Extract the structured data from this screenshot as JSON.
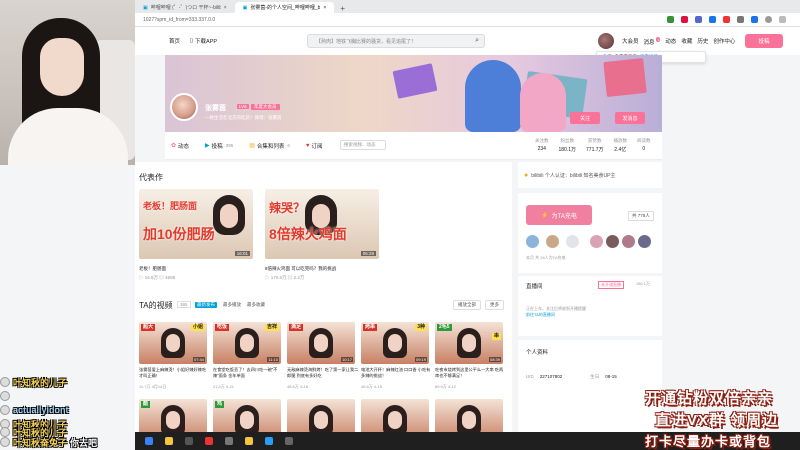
{
  "browser": {
    "tabs": [
      {
        "label": "哔哩哔哩 (゜-゜)つロ 干杯~-bilibili",
        "active": false
      },
      {
        "label": "张雾茵-的个人空间_哔哩哔哩_bilibili",
        "active": true
      }
    ],
    "url": "1027?spm_id_from=333.337.0.0"
  },
  "site_header": {
    "home": "首页",
    "app": "下载APP",
    "search_placeholder": "【熟肉】地铁飞胸比赛的骚货，看见追尾了！",
    "nav": [
      "大会员",
      "消息",
      "动态",
      "收藏",
      "历史",
      "创作中心"
    ],
    "upload": "投稿",
    "message_badge": "1",
    "tooltip": "你有6条充电消息",
    "tooltip_link": "查看详情"
  },
  "profile": {
    "name": "张雾茵",
    "level": "LV6",
    "vip": "年度大会员",
    "bio": "一枚生活在北京的吃货！微博：张雾茵",
    "follow": "关注",
    "message": "发消息"
  },
  "profile_nav": {
    "items": [
      {
        "label": "动态",
        "count": ""
      },
      {
        "label": "投稿",
        "count": "395"
      },
      {
        "label": "合集和列表",
        "count": "6"
      },
      {
        "label": "订阅",
        "count": ""
      }
    ],
    "search_placeholder": "搜索视频、动态"
  },
  "stats": [
    {
      "label": "关注数",
      "value": "234"
    },
    {
      "label": "粉丝数",
      "value": "180.1万"
    },
    {
      "label": "获赞数",
      "value": "771.7万"
    },
    {
      "label": "播放数",
      "value": "2.4亿"
    },
    {
      "label": "阅读数",
      "value": "0"
    }
  ],
  "representative": {
    "heading": "代表作",
    "items": [
      {
        "thumb_line1": "老板！肥肠面",
        "thumb_line2": "加10份肥肠",
        "duration": "16:01",
        "title": "老板！肥肠面",
        "views": "16.8万",
        "danmaku": "4698"
      },
      {
        "thumb_line1": "辣哭？",
        "thumb_line2": "8倍辣火鸡面",
        "duration": "06:29",
        "title": "8倍辣火鸡面 可以吃完吗？我的挑战",
        "views": "170.6万",
        "danmaku": "2.2万"
      }
    ]
  },
  "videos": {
    "heading": "TA的视频",
    "count": "395",
    "tabs": [
      "最新发布",
      "最多播放",
      "最多收藏"
    ],
    "buttons": [
      "播放全部",
      "更多"
    ],
    "items": [
      {
        "tag": "超大",
        "tag2": "小姐",
        "duration": "07:44",
        "title": "张雾茵爱上麻辣烫！小姐好辣好辣吃 才叫正确！",
        "views": "11.7万",
        "date": "4月14日"
      },
      {
        "tag": "吃饭",
        "tag2": "吉祥",
        "duration": "11:10",
        "title": "在食堂吃饭丢了！去四川吃一碗\"不辣\"面条 金年单面",
        "views": "21.5万",
        "date": "4-21"
      },
      {
        "tag": "满足",
        "tag2": "",
        "duration": "10:17",
        "title": "无敌麻辣烫海鲜烤！吃了第一家让我二郎腿 到底有多好吃",
        "views": "48.6万",
        "date": "4-18"
      },
      {
        "tag": "烤串",
        "tag2": "3种",
        "duration": "09:19",
        "title": "电池大开杯！麻辣红油 口口香 小吃有多辣的挑战！",
        "views": "46.8万",
        "date": "4-15"
      },
      {
        "tag": "2毛5",
        "tag2": "串",
        "duration": "08:39",
        "title": "吃夜市烧烤到这里公平么一大串 吃两串也不够满足！",
        "views": "69.9万",
        "date": "4-12"
      },
      {
        "tag": "醋",
        "tag2": "",
        "duration": "",
        "title": "",
        "views": "",
        "date": ""
      },
      {
        "tag": "鸡",
        "tag2": "",
        "duration": "",
        "title": "",
        "views": "",
        "date": ""
      },
      {
        "tag": "",
        "tag2": "",
        "duration": "",
        "title": "",
        "views": "",
        "date": ""
      },
      {
        "tag": "",
        "tag2": "",
        "duration": "",
        "title": "",
        "views": "",
        "date": ""
      },
      {
        "tag": "",
        "tag2": "",
        "duration": "",
        "title": "",
        "views": "",
        "date": ""
      }
    ]
  },
  "right_column": {
    "cert": "bilibili 个人认证：bilibili 知名美食UP主",
    "charge_button": "为TA充电",
    "charge_count": "共 778人",
    "charge_note": "本月 共 26人为TA充电",
    "live_title": "直播间",
    "live_status": "未开通直播",
    "live_count": "180.1万",
    "live_desc": "正在上车，关注后将收到开播提醒",
    "live_link": "前往TA的直播间",
    "info_title": "个人资料",
    "uid_label": "UID",
    "uid_value": "227107802",
    "birthday_label": "生日",
    "birthday_value": "08-15"
  },
  "chat_overlay": [
    {
      "user": "叶知秋的儿子",
      "msg": ""
    },
    {
      "user": "",
      "msg": ""
    },
    {
      "user": "actuallyidont",
      "msg": ""
    },
    {
      "user": "叶知秋的儿子",
      "msg": ""
    },
    {
      "user": "叶知秋的儿子",
      "msg": ""
    },
    {
      "user": "叶知秋奋兔子",
      "msg": "你去吧"
    }
  ],
  "ad_overlay": [
    "开通钻粉双倍亲亲",
    "直进VX群 领周边",
    "打卡尽量办卡或背包"
  ],
  "colors": {
    "accent": "#fb7299",
    "link": "#00a1d6",
    "chat_name": "#f6d35a"
  }
}
